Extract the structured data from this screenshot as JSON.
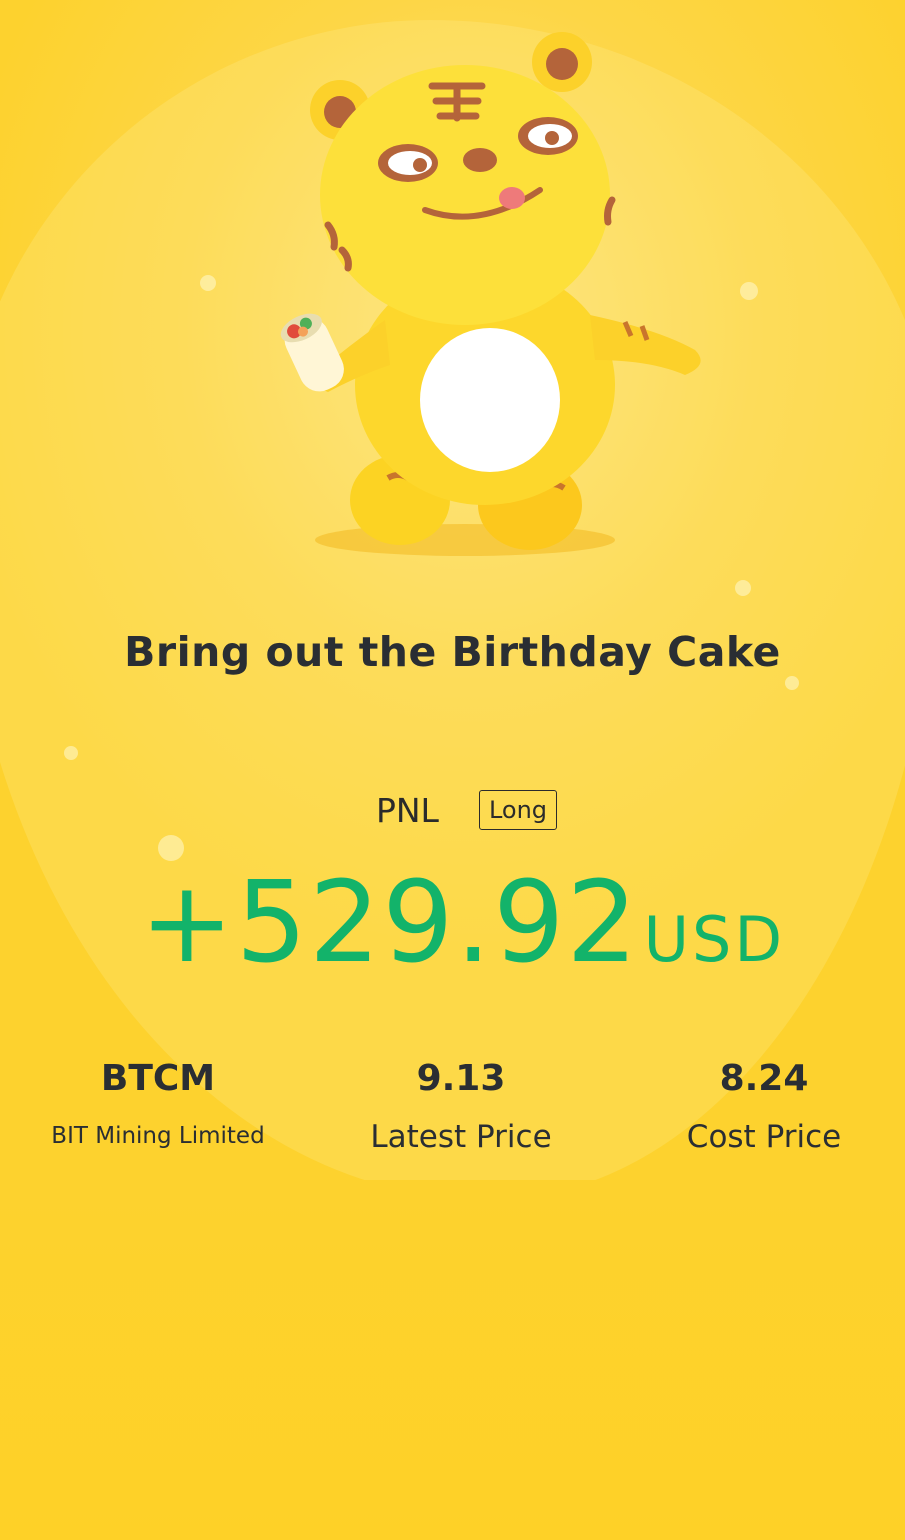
{
  "card": {
    "title": "Bring out the Birthday Cake",
    "pnl_label": "PNL",
    "position_badge": "Long",
    "pnl_value": "+529.92",
    "pnl_currency": "USD",
    "pnl_color": "#13b36a",
    "background_color": "#fdd632"
  },
  "stock": {
    "ticker": "BTCM",
    "name": "BIT Mining Limited",
    "latest_price": "9.13",
    "latest_price_label": "Latest Price",
    "cost_price": "8.24",
    "cost_price_label": "Cost Price"
  },
  "illustration": {
    "icon": "tiger-mascot-holding-burrito-icon"
  }
}
